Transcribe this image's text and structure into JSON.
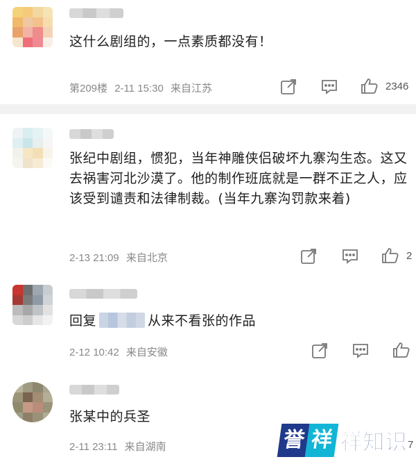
{
  "comments": [
    {
      "text": "这什么剧组的，一点素质都没有！",
      "floor": "第209楼",
      "time": "2-11 15:30",
      "location": "来自江苏",
      "likes": "2346"
    },
    {
      "text": "张纪中剧组，惯犯，当年神雕侠侣破坏九寨沟生态。这又去祸害河北沙漠了。他的制作班底就是一群不正之人，应该受到谴责和法律制裁。(当年九寨沟罚款来着)",
      "time": "2-13 21:09",
      "location": "来自北京",
      "likes": "2"
    },
    {
      "reply_prefix": "回复",
      "text": "从来不看张的作品",
      "time": "2-12 10:42",
      "location": "来自安徽"
    },
    {
      "text": "张某中的兵圣",
      "time": "2-11 23:11",
      "location": "来自湖南",
      "likes": "7"
    }
  ],
  "icons": [
    "share-icon",
    "comment-icon",
    "like-icon"
  ],
  "watermark": {
    "part1": "誉",
    "part2": "祥",
    "part3": "祥知识"
  },
  "colors": {
    "meta": "#888888",
    "separator": "#f1f1f1",
    "brand_blue": "#1f3a8a",
    "brand_cyan": "#12b5d6"
  }
}
